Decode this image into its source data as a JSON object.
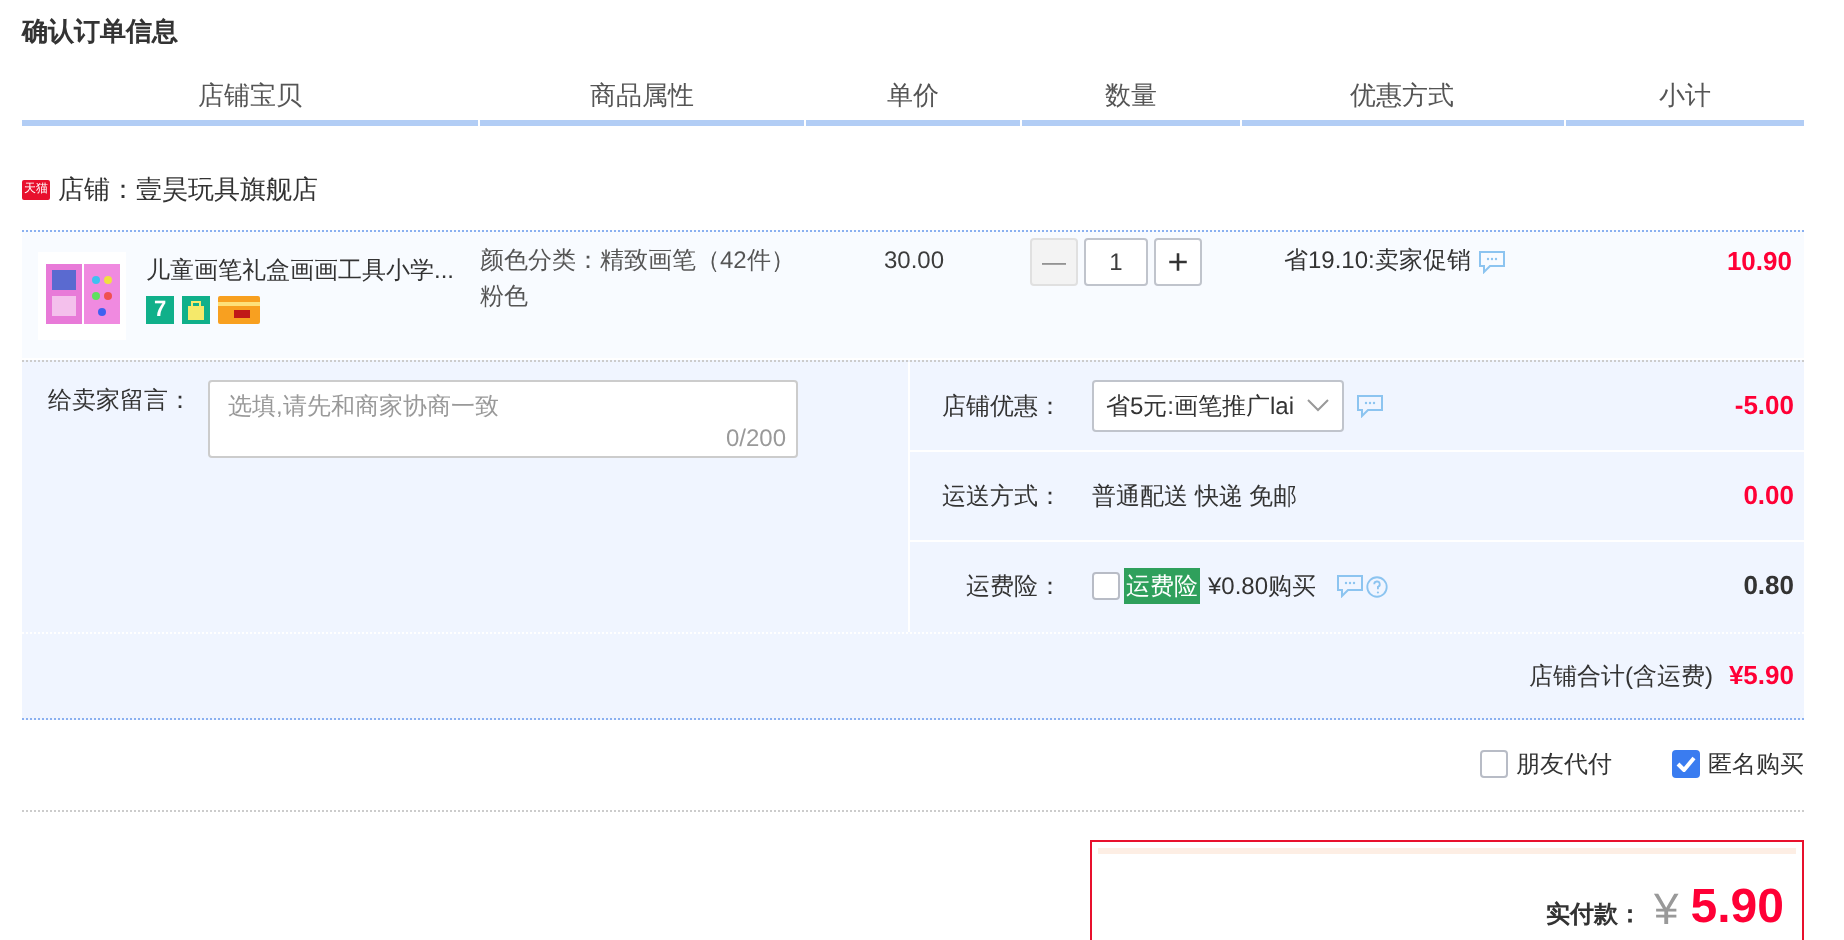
{
  "title": "确认订单信息",
  "columns": [
    "店铺宝贝",
    "商品属性",
    "单价",
    "数量",
    "优惠方式",
    "小计"
  ],
  "shop": {
    "badge": "天猫",
    "name": "店铺：壹昊玩具旗舰店"
  },
  "item": {
    "name": "儿童画笔礼盒画画工具小学...",
    "service_badges": [
      "7"
    ],
    "attributes": [
      "颜色分类：精致画笔（42件）",
      "粉色"
    ],
    "price": "30.00",
    "quantity": {
      "minus": "—",
      "value": "1",
      "plus": "+",
      "minus_disabled": true
    },
    "promotion": "省19.10:卖家促销",
    "subtotal": "10.90"
  },
  "message": {
    "label": "给卖家留言：",
    "placeholder": "选填,请先和商家协商一致",
    "counter": "0/200"
  },
  "options": [
    {
      "kind": "select",
      "label": "店铺优惠：",
      "value": "省5元:画笔推广lai",
      "amount": "-5.00",
      "highlight": true
    },
    {
      "kind": "text",
      "label": "运送方式：",
      "value": "普通配送 快递 免邮",
      "amount": "0.00",
      "highlight": true
    },
    {
      "kind": "checkbox",
      "label": "运费险：",
      "tag": "运费险",
      "value": "¥0.80购买",
      "checked": false,
      "amount": "0.80",
      "highlight": false
    }
  ],
  "shop_total": {
    "label": "店铺合计(含运费)",
    "amount": "¥5.90"
  },
  "extras": [
    {
      "label": "朋友代付",
      "checked": false
    },
    {
      "label": "匿名购买",
      "checked": true
    }
  ],
  "payment": {
    "label": "实付款：",
    "currency": "¥",
    "amount": "5.90"
  }
}
